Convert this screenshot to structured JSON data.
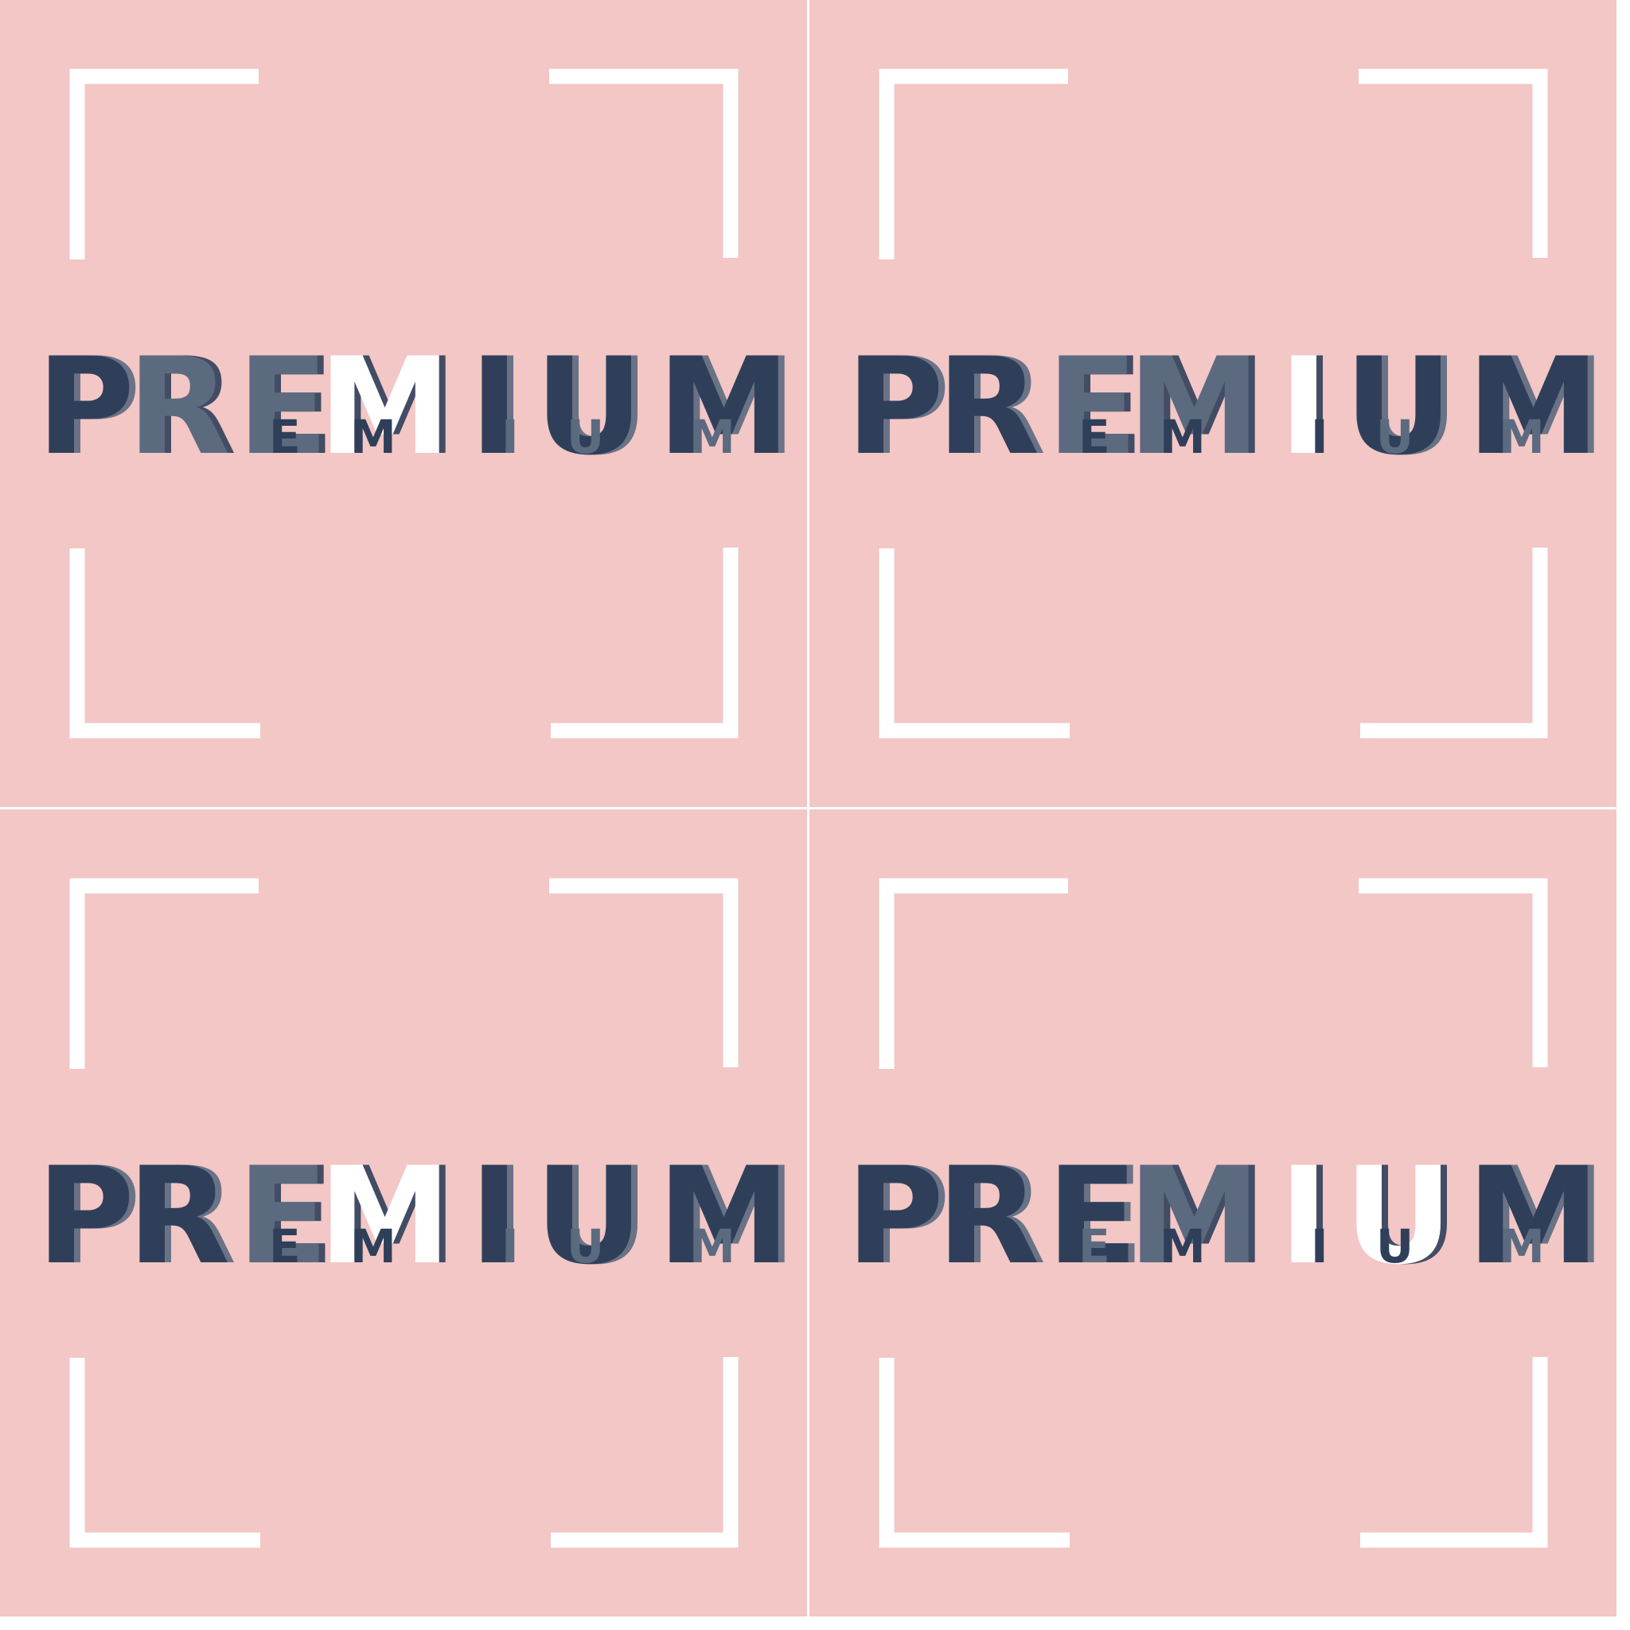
{
  "colors": {
    "tile_background": "#f2c7c5",
    "separator": "#ffffff",
    "bracket": "#ffffff",
    "navy": "#2f3f5a",
    "slate": "#5c6a80",
    "white": "#ffffff"
  },
  "tiles": [
    {
      "id": "top-left",
      "text": "PREMIUM",
      "letters": [
        {
          "char": "P",
          "color": "navy"
        },
        {
          "char": "R",
          "color": "slate"
        },
        {
          "char": "E",
          "color": "slate"
        },
        {
          "char": "M",
          "color": "white"
        },
        {
          "char": "I",
          "color": "navy"
        },
        {
          "char": "U",
          "color": "navy"
        },
        {
          "char": "M",
          "color": "navy"
        }
      ]
    },
    {
      "id": "top-right",
      "text": "PREMIUM",
      "letters": [
        {
          "char": "P",
          "color": "navy"
        },
        {
          "char": "R",
          "color": "navy"
        },
        {
          "char": "E",
          "color": "slate"
        },
        {
          "char": "M",
          "color": "slate"
        },
        {
          "char": "I",
          "color": "white"
        },
        {
          "char": "U",
          "color": "navy"
        },
        {
          "char": "M",
          "color": "navy"
        }
      ]
    },
    {
      "id": "bottom-left",
      "text": "PREMIUM",
      "letters": [
        {
          "char": "P",
          "color": "navy"
        },
        {
          "char": "R",
          "color": "navy"
        },
        {
          "char": "E",
          "color": "slate"
        },
        {
          "char": "M",
          "color": "white"
        },
        {
          "char": "I",
          "color": "navy"
        },
        {
          "char": "U",
          "color": "navy"
        },
        {
          "char": "M",
          "color": "navy"
        }
      ]
    },
    {
      "id": "bottom-right",
      "text": "PREMIUM",
      "letters": [
        {
          "char": "P",
          "color": "navy"
        },
        {
          "char": "R",
          "color": "navy"
        },
        {
          "char": "E",
          "color": "navy"
        },
        {
          "char": "M",
          "color": "slate"
        },
        {
          "char": "I",
          "color": "white"
        },
        {
          "char": "U",
          "color": "white"
        },
        {
          "char": "M",
          "color": "navy"
        }
      ]
    }
  ]
}
